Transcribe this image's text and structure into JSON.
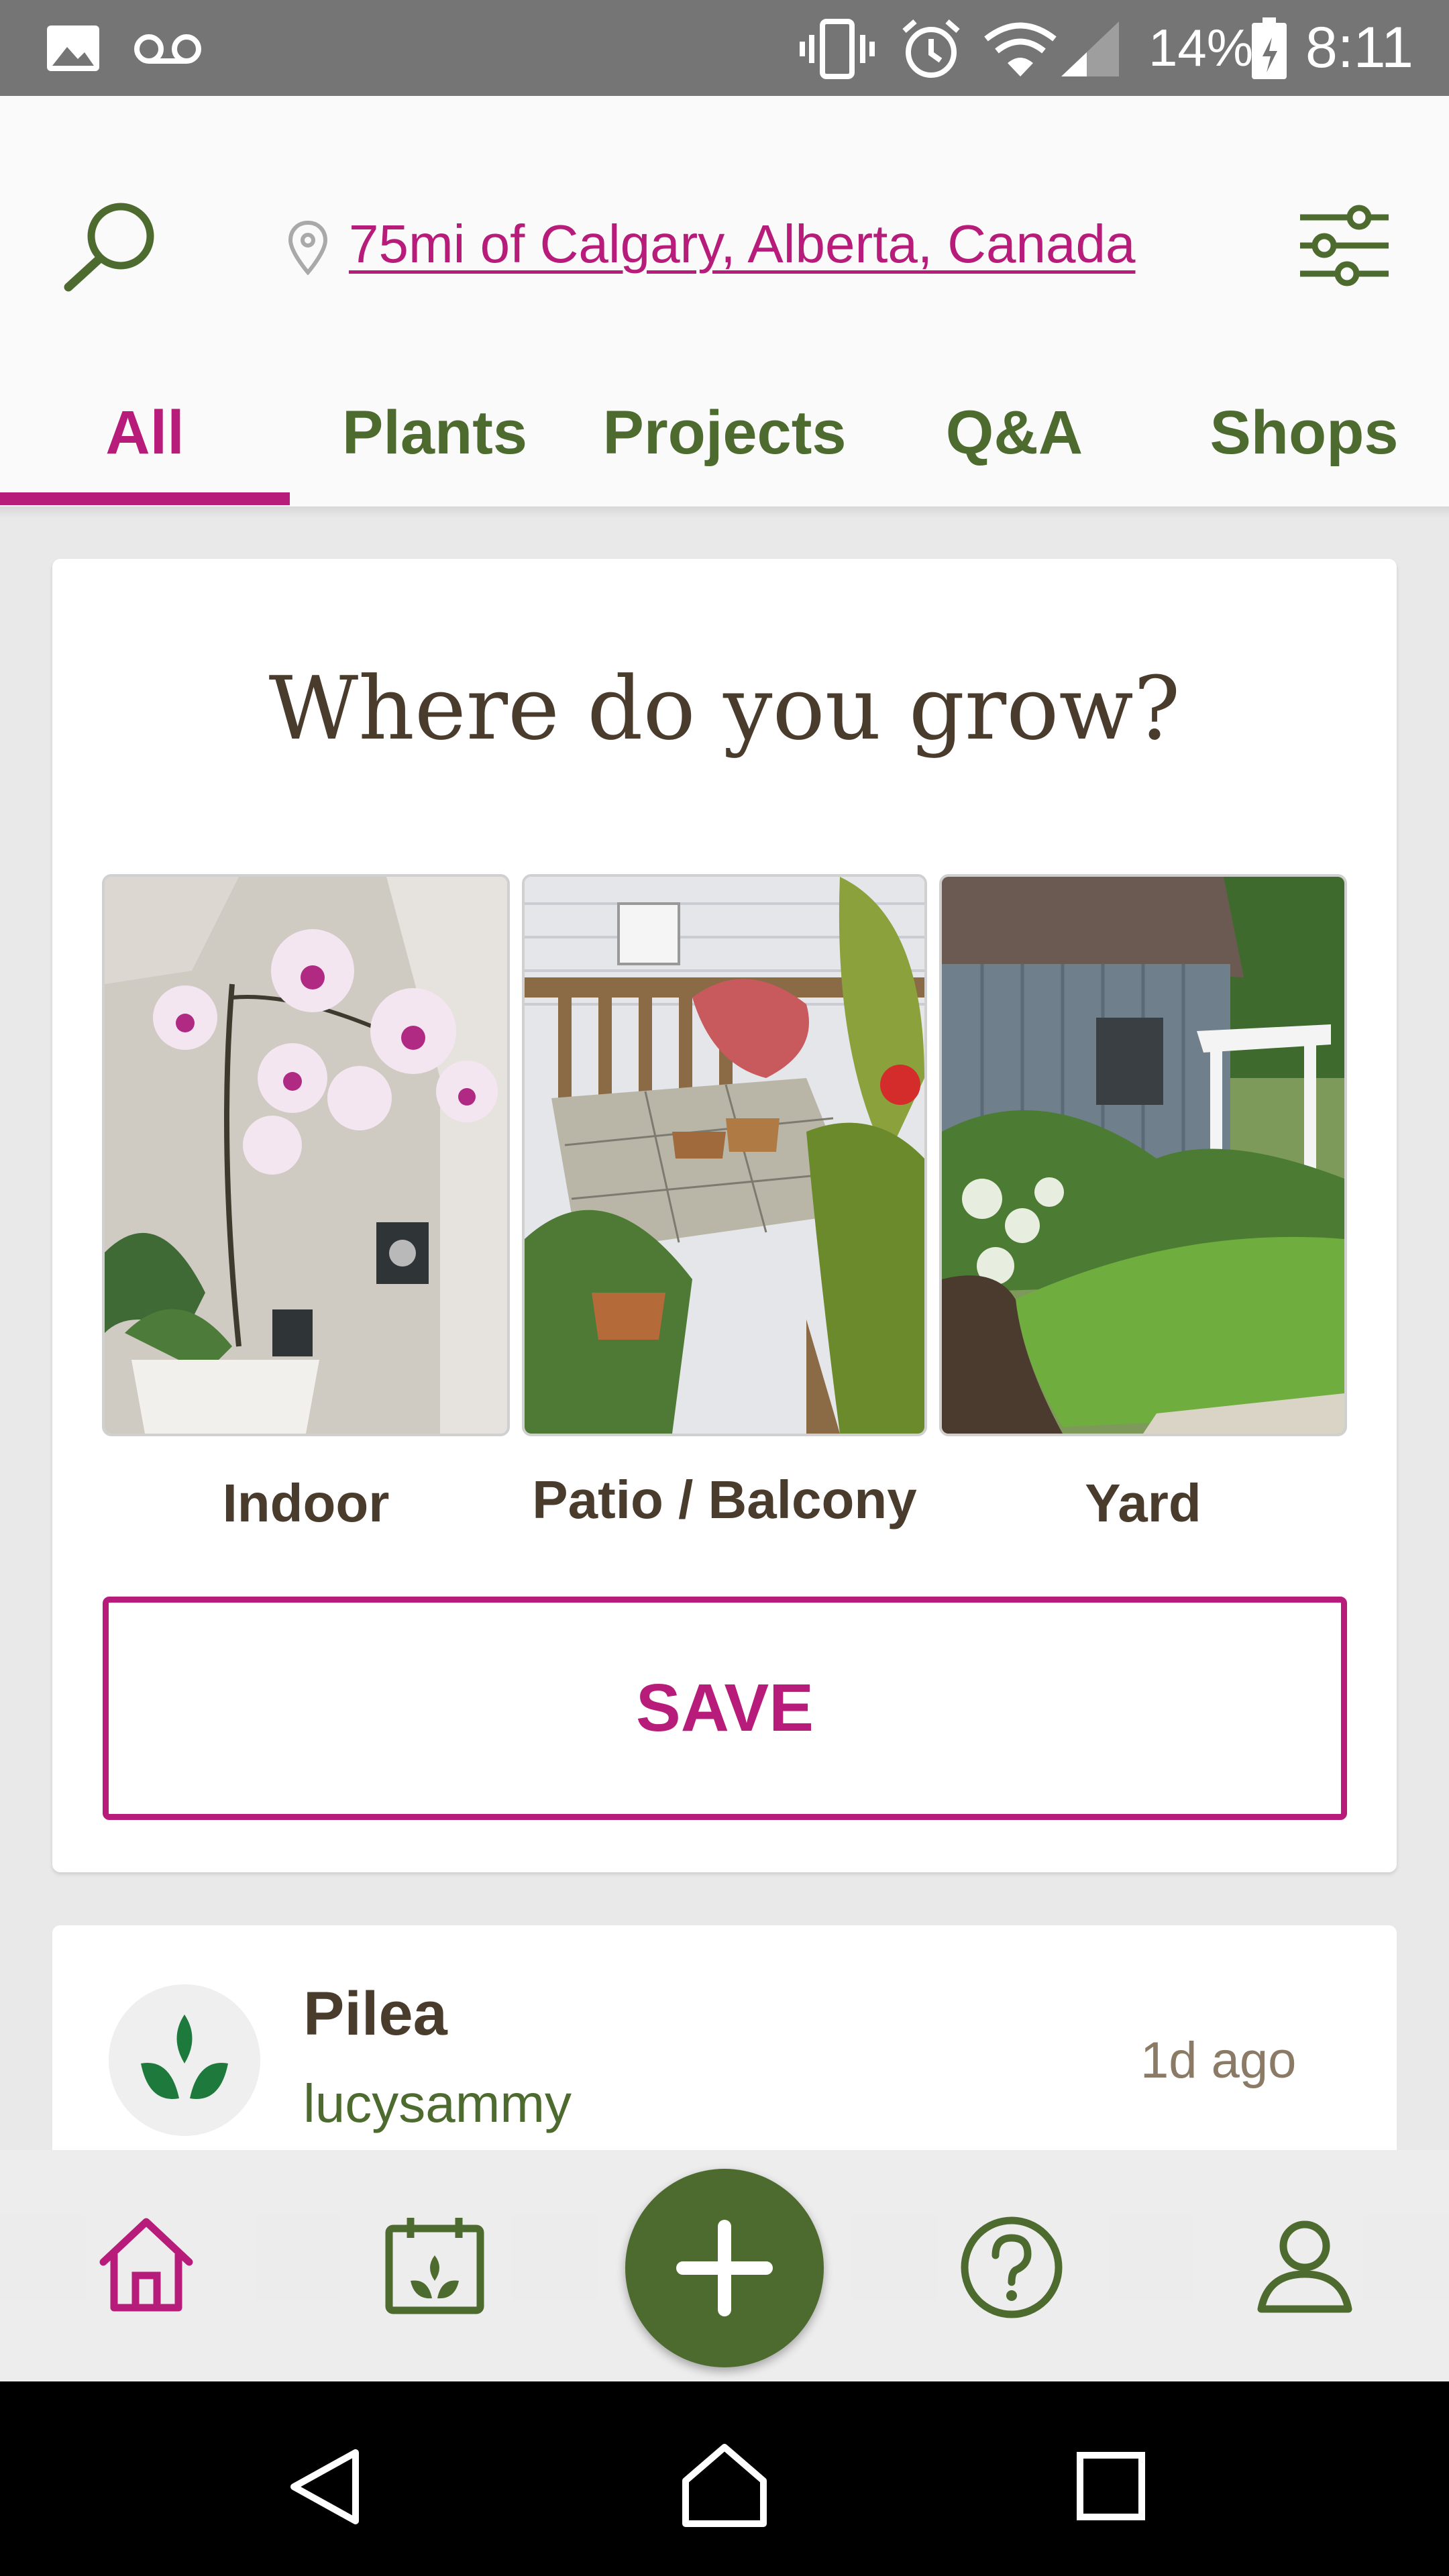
{
  "status_bar": {
    "battery": "14%",
    "time": "8:11",
    "icons": [
      "image-icon",
      "voicemail-icon",
      "vibrate-icon",
      "alarm-icon",
      "wifi-icon",
      "signal-icon",
      "battery-icon"
    ]
  },
  "header": {
    "location": "75mi of Calgary, Alberta, Canada",
    "tabs": [
      "All",
      "Plants",
      "Projects",
      "Q&A",
      "Shops"
    ],
    "active_tab": "All"
  },
  "grow_card": {
    "title": "Where do you grow?",
    "options": [
      "Indoor",
      "Patio / Balcony",
      "Yard"
    ],
    "save_label": "SAVE"
  },
  "post": {
    "title": "Pilea",
    "user": "lucysammy",
    "time": "1d ago"
  },
  "bottom_nav": {
    "items": [
      "home-icon",
      "calendar-plant-icon",
      "add-icon",
      "question-icon",
      "profile-icon"
    ],
    "active": "home-icon"
  },
  "colors": {
    "accent": "#b71c7a",
    "green": "#4d6b2e",
    "brown": "#4a3c2c"
  }
}
